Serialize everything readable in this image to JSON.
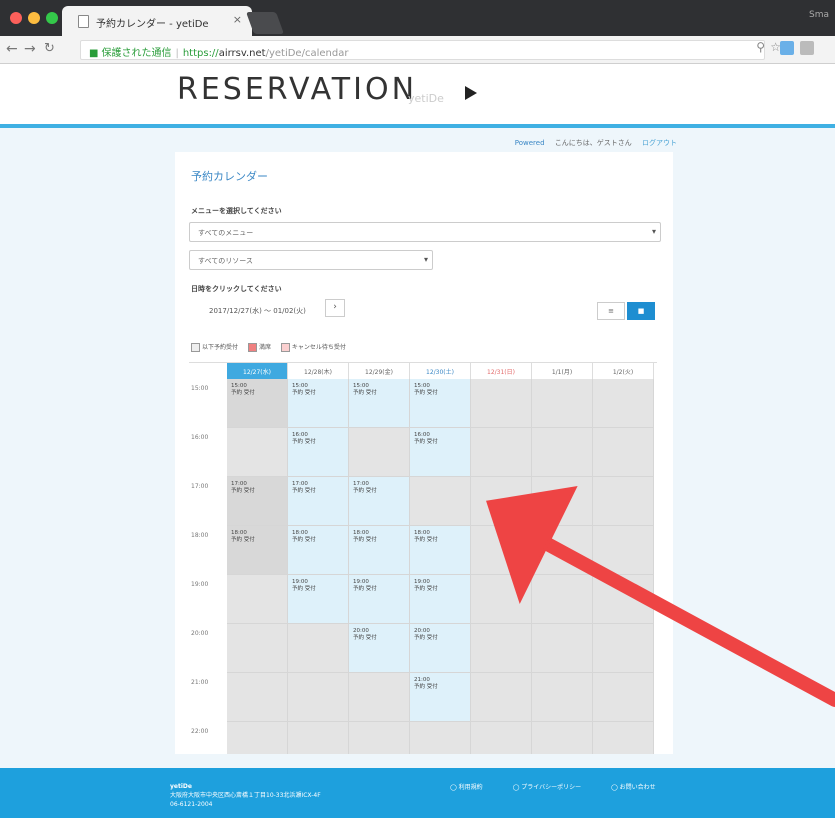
{
  "browser": {
    "tab_title": "予約カレンダー - yetiDe",
    "close_glyph": "×",
    "user": "Sma",
    "secure_label": "保護された通信",
    "url_scheme": "https://",
    "url_host": "airrsv.net",
    "url_path": "/yetiDe/calendar"
  },
  "header": {
    "logo": "RESERVATION",
    "brand": "yetiDe"
  },
  "userline": {
    "powered": "Powered",
    "greeting": "こんにちは、ゲストさん",
    "logout": "ログアウト"
  },
  "card": {
    "title": "予約カレンダー",
    "menu_label": "メニューを選択してください",
    "menu_value": "すべてのメニュー",
    "resource_value": "すべてのリソース",
    "date_label": "日時をクリックしてください",
    "range": "2017/12/27(水) ～ 01/02(火)",
    "next_glyph": "›",
    "view_list": "≡",
    "view_grid": "■"
  },
  "legend": [
    {
      "label": "以下予約受付",
      "color": "#eeeeee"
    },
    {
      "label": "満席",
      "color": "#f08080"
    },
    {
      "label": "キャンセル待ち受付",
      "color": "#fbd0d0"
    }
  ],
  "calendar": {
    "days": [
      {
        "label": "12/27(水)",
        "kind": "today"
      },
      {
        "label": "12/28(木)",
        "kind": "normal"
      },
      {
        "label": "12/29(金)",
        "kind": "normal"
      },
      {
        "label": "12/30(土)",
        "kind": "sat"
      },
      {
        "label": "12/31(日)",
        "kind": "sun"
      },
      {
        "label": "1/1(月)",
        "kind": "normal"
      },
      {
        "label": "1/2(火)",
        "kind": "normal"
      }
    ],
    "hours": [
      "15:00",
      "16:00",
      "17:00",
      "18:00",
      "19:00",
      "20:00",
      "21:00",
      "22:00"
    ],
    "slot_text": "予約 受付",
    "grid": [
      [
        "past:15:00",
        "b:15:00",
        "b:15:00",
        "b:15:00",
        "g",
        "g",
        "g"
      ],
      [
        "g",
        "b:16:00",
        "g",
        "b:16:00",
        "g",
        "g",
        "g"
      ],
      [
        "past:17:00",
        "b:17:00",
        "b:17:00",
        "g",
        "g",
        "g",
        "g"
      ],
      [
        "past:18:00",
        "b:18:00",
        "b:18:00",
        "b:18:00",
        "g",
        "g",
        "g"
      ],
      [
        "g",
        "b:19:00",
        "b:19:00",
        "b:19:00",
        "g",
        "g",
        "g"
      ],
      [
        "g",
        "g",
        "b:20:00",
        "b:20:00",
        "g",
        "g",
        "g"
      ],
      [
        "g",
        "g",
        "g",
        "b:21:00",
        "g",
        "g",
        "g"
      ],
      [
        "g",
        "g",
        "g",
        "g",
        "g",
        "g",
        "g"
      ]
    ]
  },
  "footer": {
    "name": "yetiDe",
    "address": "大阪府大阪市中央区西心斎橋１丁目10-33北浜瀬ICX-4F",
    "phone": "06-6121-2004",
    "links": [
      "利用規約",
      "プライバシーポリシー",
      "お問い合わせ"
    ]
  },
  "colors": {
    "accent": "#3fb0e3",
    "footer": "#1ea0dd",
    "arrow": "#ee4444"
  }
}
